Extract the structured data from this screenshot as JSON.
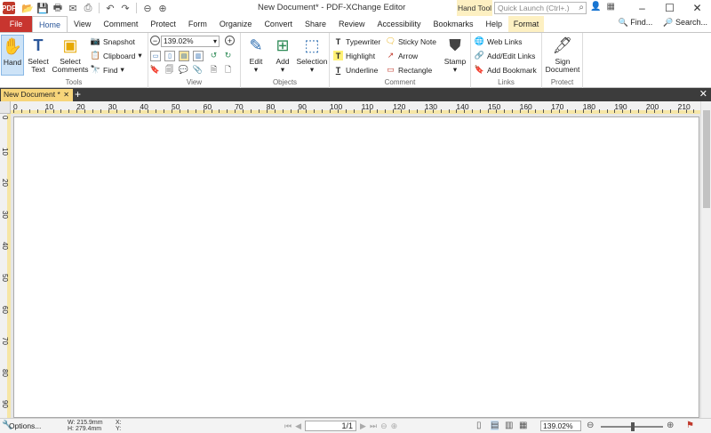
{
  "titlebar": {
    "app_icon": "PDF",
    "title": "New Document* - PDF-XChange Editor",
    "context_tab": "Hand Tool",
    "quick_launch_placeholder": "Quick Launch (Ctrl+.)",
    "find_label": "Find...",
    "search_label": "Search..."
  },
  "tabs": [
    "File",
    "Home",
    "View",
    "Comment",
    "Protect",
    "Form",
    "Organize",
    "Convert",
    "Share",
    "Review",
    "Accessibility",
    "Bookmarks",
    "Help",
    "Format"
  ],
  "ribbon": {
    "tools": {
      "label": "Tools",
      "hand": "Hand",
      "select_text": "Select Text",
      "select_comments": "Select Comments",
      "snapshot": "Snapshot",
      "clipboard": "Clipboard",
      "find": "Find"
    },
    "view": {
      "label": "View",
      "zoom_value": "139.02%"
    },
    "objects": {
      "label": "Objects",
      "edit": "Edit",
      "add": "Add",
      "selection": "Selection"
    },
    "comment": {
      "label": "Comment",
      "typewriter": "Typewriter",
      "highlight": "Highlight",
      "underline": "Underline",
      "sticky_note": "Sticky Note",
      "arrow": "Arrow",
      "rectangle": "Rectangle",
      "stamp": "Stamp"
    },
    "links": {
      "label": "Links",
      "web_links": "Web Links",
      "add_edit_links": "Add/Edit Links",
      "add_bookmark": "Add Bookmark"
    },
    "protect": {
      "label": "Protect",
      "sign_document": "Sign Document"
    }
  },
  "document": {
    "tab_name": "New Document *"
  },
  "ruler": {
    "h_ticks": [
      "0",
      "10",
      "20",
      "30",
      "40",
      "50",
      "60",
      "70",
      "80",
      "90",
      "100",
      "110",
      "120",
      "130",
      "140",
      "150",
      "160",
      "170",
      "180",
      "190",
      "200",
      "210"
    ],
    "v_ticks": [
      "0",
      "10",
      "20",
      "30",
      "40",
      "50",
      "60",
      "70",
      "80",
      "90"
    ]
  },
  "status": {
    "options": "Options...",
    "width": "W: 215.9mm",
    "height": "H: 279.4mm",
    "x": "X:",
    "y": "Y:",
    "page": "1/1",
    "zoom": "139.02%"
  }
}
